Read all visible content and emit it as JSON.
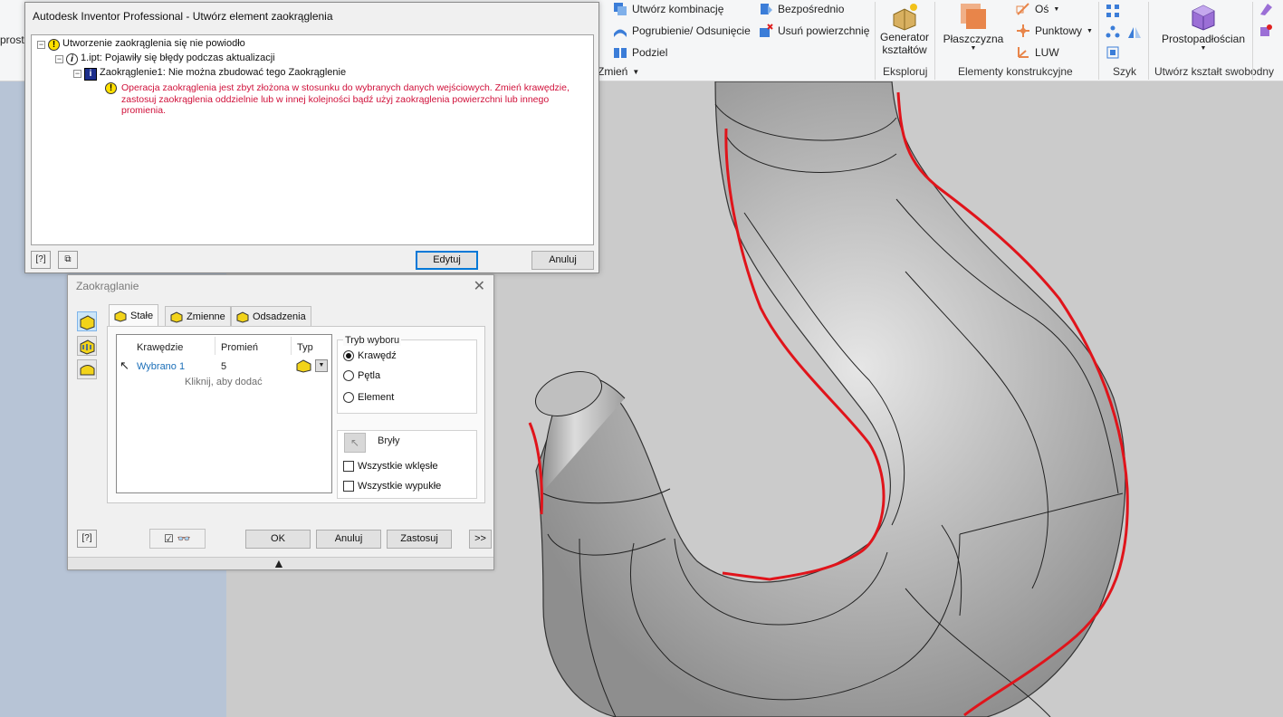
{
  "ribbon": {
    "left_cut_text": "prost",
    "items": {
      "utworz_kombinacje": "Utwórz kombinację",
      "pogrubienie": "Pogrubienie/ Odsunięcie",
      "podziel": "Podziel",
      "bezposrednio": "Bezpośrednio",
      "usun_powierzchnie": "Usuń powierzchnię",
      "zmien": "Zmień",
      "generator_line1": "Generator",
      "generator_line2": "kształtów",
      "plaszczyzna": "Płaszczyzna",
      "os": "Oś",
      "punktowy": "Punktowy",
      "luw": "LUW",
      "prostopadloscian": "Prostopadłościan"
    },
    "groups": {
      "eksploruj": "Eksploruj",
      "elementy_konstrukcyjne": "Elementy konstrukcyjne",
      "szyk": "Szyk",
      "utworz_ksztalt": "Utwórz kształt swobodny"
    },
    "colors": {
      "accent_blue": "#3b7dd8",
      "plane_orange": "#e8854a",
      "box_purple": "#9b6fd6"
    }
  },
  "error_dialog": {
    "title": "Autodesk Inventor Professional - Utwórz element zaokrąglenia",
    "tree": [
      {
        "text": "Utworzenie zaokrąglenia się nie powiodło",
        "icon": "warning-icon"
      },
      {
        "text": "1.ipt: Pojawiły się błędy podczas aktualizacji",
        "icon": "info-icon"
      },
      {
        "text": "Zaokrąglenie1: Nie można zbudować tego Zaokrąglenie",
        "icon": "info-blue-icon"
      },
      {
        "text": "Operacja zaokrąglenia jest zbyt złożona w stosunku do wybranych danych wejściowych. Zmień krawędzie, zastosuj zaokrąglenia oddzielnie lub w innej kolejności bądź użyj zaokrąglenia powierzchni lub innego promienia.",
        "icon": "warning-icon"
      }
    ],
    "edit_label": "Edytuj",
    "cancel_label": "Anuluj",
    "error_color": "#d0103a"
  },
  "fillet_dialog": {
    "title": "Zaokrąglanie",
    "tabs": [
      "Stałe",
      "Zmienne",
      "Odsadzenia"
    ],
    "table": {
      "headers": [
        "Krawędzie",
        "Promień",
        "Typ"
      ],
      "row": {
        "edges": "Wybrano 1",
        "radius": "5"
      },
      "add_hint": "Kliknij, aby dodać"
    },
    "selection_mode": {
      "label": "Tryb wyboru",
      "options": [
        "Krawędź",
        "Pętla",
        "Element"
      ],
      "selected": "Krawędź"
    },
    "solids_label": "Bryły",
    "all_concave": "Wszystkie wklęsłe",
    "all_convex": "Wszystkie wypukłe",
    "ok_label": "OK",
    "cancel_label": "Anuluj",
    "apply_label": "Zastosuj",
    "more_label": ">>"
  }
}
